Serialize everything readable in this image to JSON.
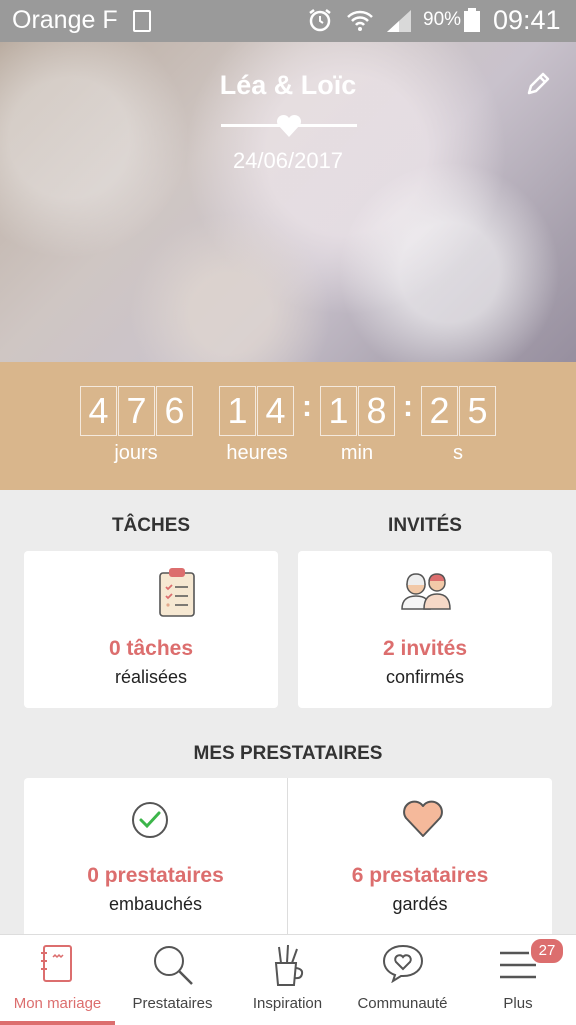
{
  "status_bar": {
    "carrier": "Orange F",
    "battery": "90%",
    "time": "09:41"
  },
  "header": {
    "couple": "Léa & Loïc",
    "date": "24/06/2017"
  },
  "countdown": {
    "days": [
      "4",
      "7",
      "6"
    ],
    "hours": [
      "1",
      "4"
    ],
    "minutes": [
      "1",
      "8"
    ],
    "seconds": [
      "2",
      "5"
    ],
    "labels": {
      "days": "jours",
      "hours": "heures",
      "minutes": "min",
      "seconds": "s"
    }
  },
  "tasks": {
    "title": "TÂCHES",
    "count": "0 tâches",
    "sub": "réalisées"
  },
  "guests": {
    "title": "INVITÉS",
    "count": "2 invités",
    "sub": "confirmés"
  },
  "vendors": {
    "title": "MES PRESTATAIRES",
    "hired": {
      "count": "0 prestataires",
      "sub": "embauchés"
    },
    "saved": {
      "count": "6 prestataires",
      "sub": "gardés"
    }
  },
  "nav": {
    "items": [
      {
        "label": "Mon mariage",
        "icon": "notebook-icon"
      },
      {
        "label": "Prestataires",
        "icon": "search-icon"
      },
      {
        "label": "Inspiration",
        "icon": "pencil-cup-icon"
      },
      {
        "label": "Communauté",
        "icon": "chat-heart-icon"
      },
      {
        "label": "Plus",
        "icon": "menu-icon"
      }
    ],
    "badge": "27"
  },
  "colors": {
    "accent": "#dc6e6e",
    "countdown_bg": "#d9b68c"
  }
}
